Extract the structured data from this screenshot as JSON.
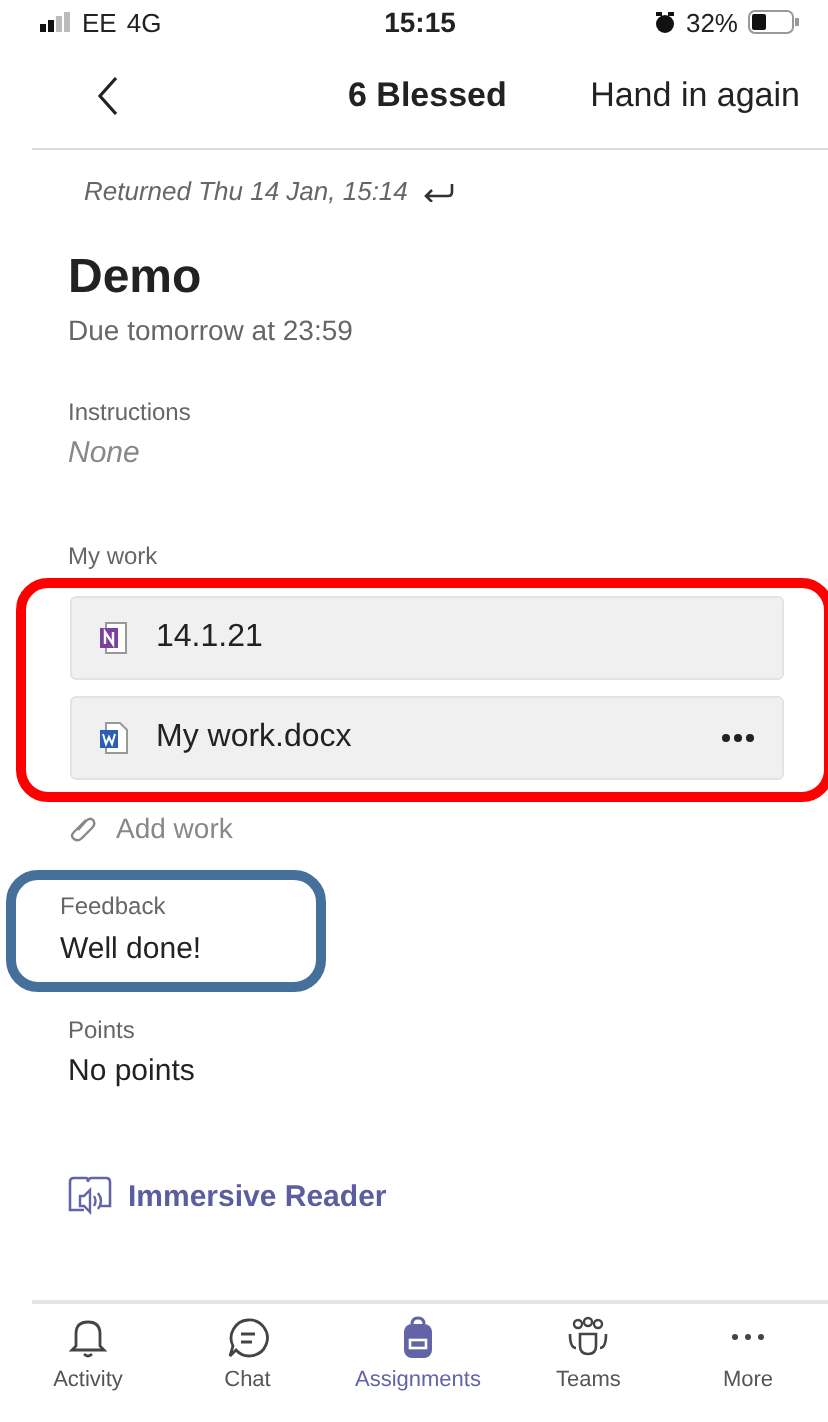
{
  "status_bar": {
    "carrier": "EE",
    "network": "4G",
    "time": "15:15",
    "battery": "32%"
  },
  "header": {
    "title": "6 Blessed",
    "action": "Hand in again"
  },
  "returned": "Returned Thu 14 Jan, 15:14",
  "assignment": {
    "title": "Demo",
    "due": "Due tomorrow at 23:59"
  },
  "instructions": {
    "label": "Instructions",
    "value": "None"
  },
  "my_work": {
    "label": "My work",
    "files": [
      {
        "kind": "onenote",
        "name": "14.1.21",
        "menu": false
      },
      {
        "kind": "word",
        "name": "My work.docx",
        "menu": true
      }
    ],
    "add": "Add work"
  },
  "feedback": {
    "label": "Feedback",
    "value": "Well done!"
  },
  "highlights": [
    {
      "kind": "my_work",
      "color": "#ff0000"
    },
    {
      "kind": "feedback",
      "color": "#46709c"
    }
  ],
  "points": {
    "label": "Points",
    "value": "No points"
  },
  "immersive_reader": "Immersive Reader",
  "tabs": [
    {
      "kind": "activity",
      "label": "Activity",
      "selected": false
    },
    {
      "kind": "chat",
      "label": "Chat",
      "selected": false
    },
    {
      "kind": "assignments",
      "label": "Assignments",
      "selected": true
    },
    {
      "kind": "teams",
      "label": "Teams",
      "selected": false
    },
    {
      "kind": "more",
      "label": "More",
      "selected": false
    }
  ]
}
